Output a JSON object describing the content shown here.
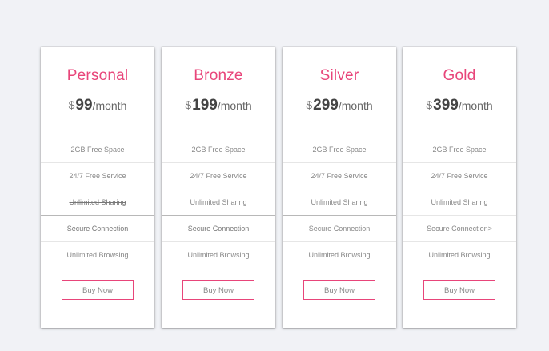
{
  "plans": [
    {
      "name": "Personal",
      "currency": "$",
      "amount": "99",
      "period": "/month",
      "features": [
        "2GB Free Space",
        "24/7 Free Service",
        "Unlimited Sharing",
        "Secure Connection",
        "Unlimited Browsing"
      ],
      "struck": [
        false,
        false,
        true,
        true,
        false
      ],
      "button": "Buy Now"
    },
    {
      "name": "Bronze",
      "currency": "$",
      "amount": "199",
      "period": "/month",
      "features": [
        "2GB Free Space",
        "24/7 Free Service",
        "Unlimited Sharing",
        "Secure Connection",
        "Unlimited Browsing"
      ],
      "struck": [
        false,
        false,
        false,
        true,
        false
      ],
      "button": "Buy Now"
    },
    {
      "name": "Silver",
      "currency": "$",
      "amount": "299",
      "period": "/month",
      "features": [
        "2GB Free Space",
        "24/7 Free Service",
        "Unlimited Sharing",
        "Secure Connection",
        "Unlimited Browsing"
      ],
      "struck": [
        false,
        false,
        false,
        false,
        false
      ],
      "button": "Buy Now"
    },
    {
      "name": "Gold",
      "currency": "$",
      "amount": "399",
      "period": "/month",
      "features": [
        "2GB Free Space",
        "24/7 Free Service",
        "Unlimited Sharing",
        "Secure Connection>",
        "Unlimited Browsing"
      ],
      "struck": [
        false,
        false,
        false,
        false,
        false
      ],
      "button": "Buy Now"
    }
  ],
  "colors": {
    "accent": "#e8457a",
    "background": "#f1f2f6"
  }
}
